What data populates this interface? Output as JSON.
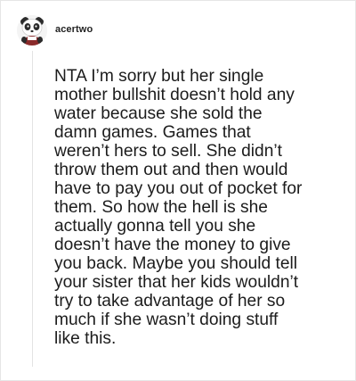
{
  "post": {
    "username": "acertwo",
    "avatar_icon": "panda-avatar-icon",
    "body": "NTA I’m sorry but her single\nmother bullshit doesn’t hold any\nwater because she sold the\ndamn games. Games that\nweren’t hers to sell. She didn’t\nthrow them out and then would\nhave to pay you out of pocket for\nthem. So how the hell is she\nactually gonna tell you she\ndoesn’t have the money to give\nyou back. Maybe you should tell\nyour sister that her kids wouldn’t\ntry to take advantage of her so\nmuch if she wasn’t doing stuff\nlike this."
  }
}
